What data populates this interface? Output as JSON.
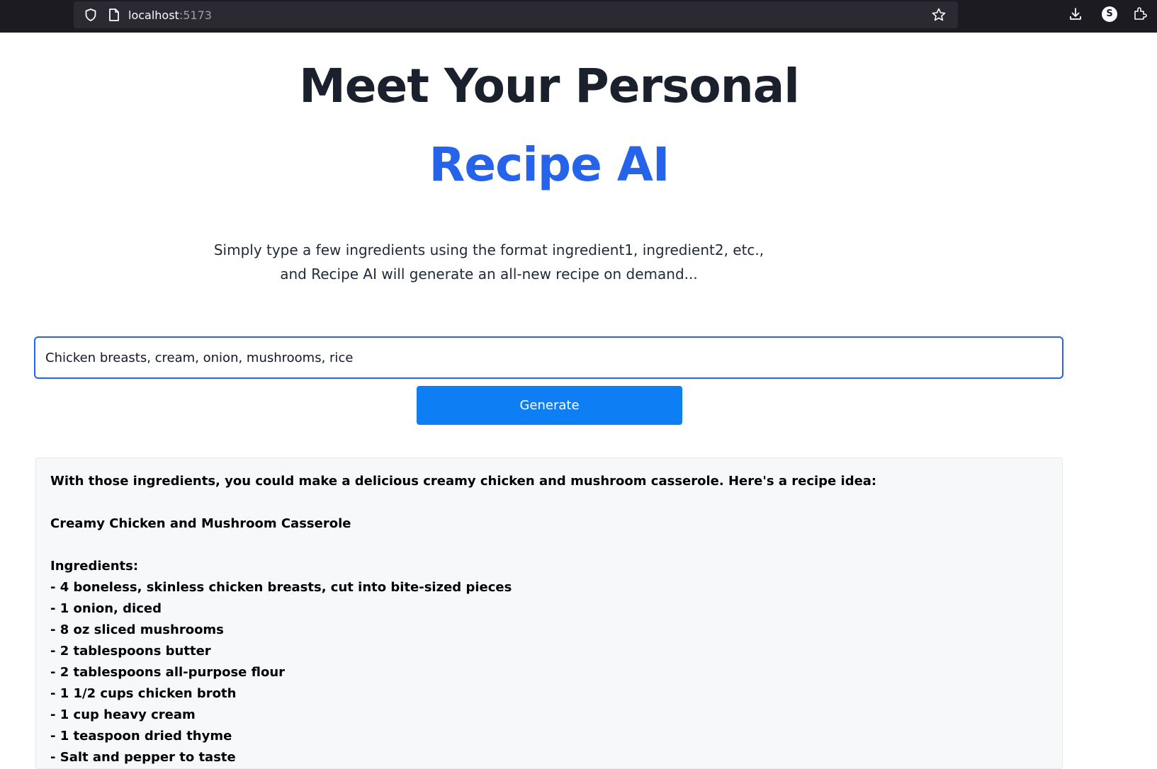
{
  "browser": {
    "url_host": "localhost",
    "url_port": ":5173",
    "account_initial": "S"
  },
  "hero": {
    "title": "Meet Your Personal",
    "subtitle": "Recipe AI",
    "description_line1": "Simply type a few ingredients using the format ingredient1, ingredient2, etc.,",
    "description_line2": "and Recipe AI will generate an all-new recipe on demand..."
  },
  "form": {
    "ingredients_value": "Chicken breasts, cream, onion, mushrooms, rice",
    "generate_label": "Generate"
  },
  "response": {
    "intro": "With those ingredients, you could make a delicious creamy chicken and mushroom casserole. Here's a recipe idea:",
    "recipe_title": "Creamy Chicken and Mushroom Casserole",
    "ingredients_heading": "Ingredients:",
    "ingredients": [
      "- 4 boneless, skinless chicken breasts, cut into bite-sized pieces",
      "- 1 onion, diced",
      "- 8 oz sliced mushrooms",
      "- 2 tablespoons butter",
      "- 2 tablespoons all-purpose flour",
      "- 1 1/2 cups chicken broth",
      "- 1 cup heavy cream",
      "- 1 teaspoon dried thyme",
      "- Salt and pepper to taste"
    ]
  },
  "colors": {
    "accent": "#2563eb",
    "button": "#0d7ef4",
    "title": "#1a202c",
    "browser_chrome": "#1c1b22"
  },
  "icons": [
    "shield-icon",
    "page-icon",
    "star-icon",
    "download-icon",
    "account-icon",
    "extensions-icon"
  ]
}
